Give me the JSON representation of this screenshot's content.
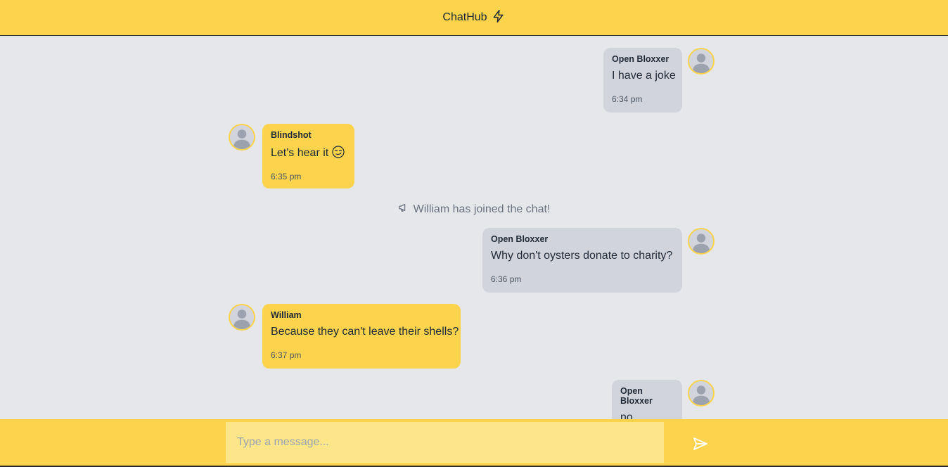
{
  "app": {
    "title": "ChatHub"
  },
  "messages": [
    {
      "sender": "Open Bloxxer",
      "text": "I have a joke",
      "time": "6:34 pm"
    },
    {
      "sender": "Blindshot",
      "text": "Let's hear it",
      "emoji": "smirking-face",
      "time": "6:35 pm"
    },
    {
      "sender": "Open Bloxxer",
      "text": "Why don't oysters donate to charity?",
      "time": "6:36 pm"
    },
    {
      "sender": "William",
      "text": "Because they can't leave their shells?",
      "time": "6:37 pm"
    },
    {
      "sender": "Open Bloxxer",
      "text": "no"
    }
  ],
  "system_notice": {
    "text": "William has joined the chat!",
    "icon": "megaphone-icon"
  },
  "composer": {
    "placeholder": "Type a message...",
    "send_icon": "send-icon"
  },
  "colors": {
    "accent": "#fcd34d",
    "own_bubble": "#d1d5db",
    "background": "#e5e7eb",
    "input": "#fde68a"
  }
}
